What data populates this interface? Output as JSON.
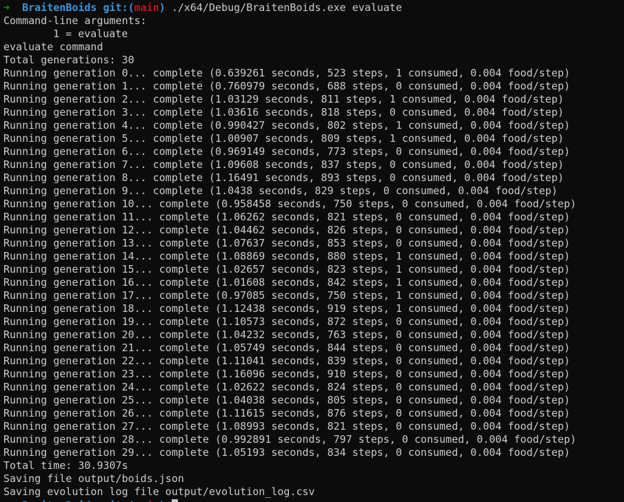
{
  "prompt": {
    "arrow": "➜",
    "dir": "BraitenBoids",
    "git_prefix": "git:(",
    "branch": "main",
    "git_suffix": ")",
    "command": "./x64/Debug/BraitenBoids.exe evaluate"
  },
  "header_lines": [
    "Command-line arguments:",
    "1 = evaluate",
    "evaluate command",
    "Total generations: 30"
  ],
  "generations": [
    "Running generation 0... complete (0.639261 seconds, 523 steps, 1 consumed, 0.004 food/step)",
    "Running generation 1... complete (0.760979 seconds, 688 steps, 0 consumed, 0.004 food/step)",
    "Running generation 2... complete (1.03129 seconds, 811 steps, 1 consumed, 0.004 food/step)",
    "Running generation 3... complete (1.03616 seconds, 818 steps, 0 consumed, 0.004 food/step)",
    "Running generation 4... complete (0.990427 seconds, 802 steps, 1 consumed, 0.004 food/step)",
    "Running generation 5... complete (1.00907 seconds, 809 steps, 1 consumed, 0.004 food/step)",
    "Running generation 6... complete (0.969149 seconds, 773 steps, 0 consumed, 0.004 food/step)",
    "Running generation 7... complete (1.09608 seconds, 837 steps, 0 consumed, 0.004 food/step)",
    "Running generation 8... complete (1.16491 seconds, 893 steps, 0 consumed, 0.004 food/step)",
    "Running generation 9... complete (1.0438 seconds, 829 steps, 0 consumed, 0.004 food/step)",
    "Running generation 10... complete (0.958458 seconds, 750 steps, 0 consumed, 0.004 food/step)",
    "Running generation 11... complete (1.06262 seconds, 821 steps, 0 consumed, 0.004 food/step)",
    "Running generation 12... complete (1.04462 seconds, 826 steps, 0 consumed, 0.004 food/step)",
    "Running generation 13... complete (1.07637 seconds, 853 steps, 0 consumed, 0.004 food/step)",
    "Running generation 14... complete (1.08869 seconds, 880 steps, 1 consumed, 0.004 food/step)",
    "Running generation 15... complete (1.02657 seconds, 823 steps, 1 consumed, 0.004 food/step)",
    "Running generation 16... complete (1.01608 seconds, 842 steps, 1 consumed, 0.004 food/step)",
    "Running generation 17... complete (0.97085 seconds, 750 steps, 1 consumed, 0.004 food/step)",
    "Running generation 18... complete (1.12438 seconds, 919 steps, 1 consumed, 0.004 food/step)",
    "Running generation 19... complete (1.10573 seconds, 872 steps, 0 consumed, 0.004 food/step)",
    "Running generation 20... complete (1.04232 seconds, 763 steps, 0 consumed, 0.004 food/step)",
    "Running generation 21... complete (1.05749 seconds, 844 steps, 0 consumed, 0.004 food/step)",
    "Running generation 22... complete (1.11041 seconds, 839 steps, 0 consumed, 0.004 food/step)",
    "Running generation 23... complete (1.16096 seconds, 910 steps, 0 consumed, 0.004 food/step)",
    "Running generation 24... complete (1.02622 seconds, 824 steps, 0 consumed, 0.004 food/step)",
    "Running generation 25... complete (1.04038 seconds, 805 steps, 0 consumed, 0.004 food/step)",
    "Running generation 26... complete (1.11615 seconds, 876 steps, 0 consumed, 0.004 food/step)",
    "Running generation 27... complete (1.08993 seconds, 821 steps, 0 consumed, 0.004 food/step)",
    "Running generation 28... complete (0.992891 seconds, 797 steps, 0 consumed, 0.004 food/step)",
    "Running generation 29... complete (1.05193 seconds, 834 steps, 0 consumed, 0.004 food/step)"
  ],
  "footer_lines": [
    "Total time: 30.9307s",
    "Saving file output/boids.json",
    "Saving evolution log file output/evolution_log.csv"
  ],
  "colors": {
    "background": "#0c0c0c",
    "text": "#cccccc",
    "arrow": "#13a10e",
    "dir": "#3a96dd",
    "branch": "#c50f1f"
  }
}
